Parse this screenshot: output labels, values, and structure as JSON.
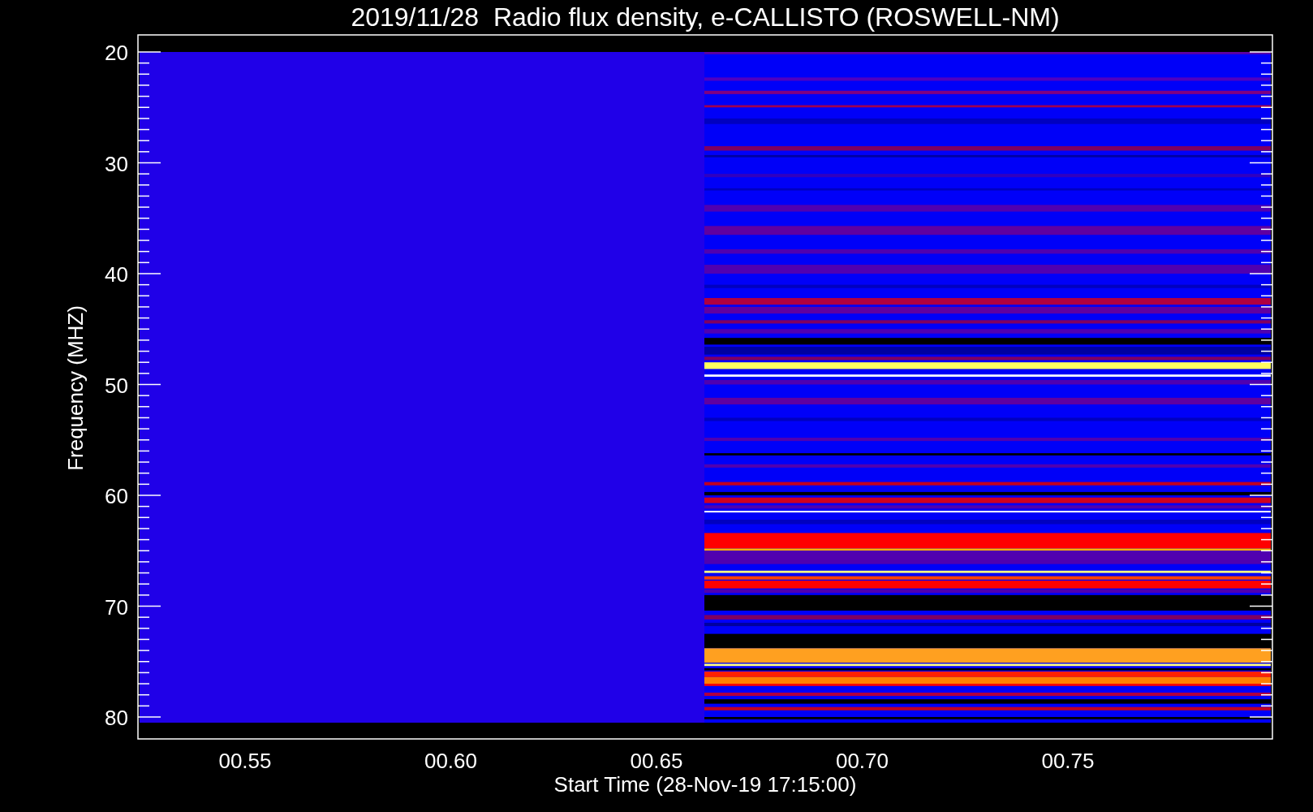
{
  "title": "2019/11/28  Radio flux density, e-CALLISTO (ROSWELL-NM)",
  "y_axis": {
    "label": "Frequency (MHZ)",
    "ticks": [
      "20",
      "30",
      "40",
      "50",
      "60",
      "70",
      "80"
    ]
  },
  "x_axis": {
    "label": "Start Time (28-Nov-19 17:15:00)",
    "ticks": [
      "00.55",
      "00.60",
      "00.65",
      "00.70",
      "00.75"
    ]
  }
}
